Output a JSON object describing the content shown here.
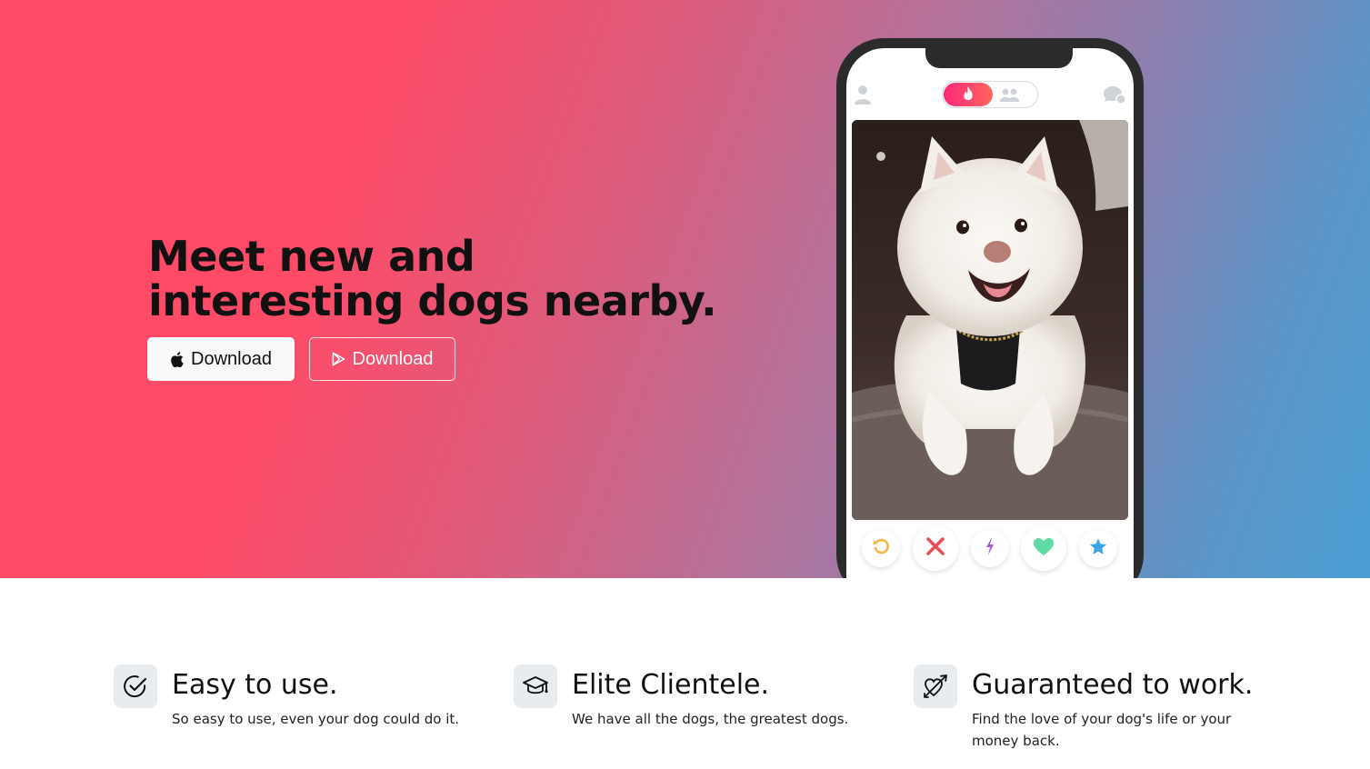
{
  "hero": {
    "title": "Meet new and interesting dogs nearby.",
    "buttons": [
      {
        "label": "Download",
        "icon": "apple-icon"
      },
      {
        "label": "Download",
        "icon": "google-play-icon"
      }
    ],
    "gradient_colors": [
      "#ff4b67",
      "#4a9ed4"
    ]
  },
  "phone": {
    "topbar": {
      "left_icon": "profile-icon",
      "toggle_active_icon": "flame-icon",
      "toggle_inactive_icon": "group-icon",
      "right_icon": "chat-icon"
    },
    "card": {
      "image": "white-pomeranian-dog-photo"
    },
    "actions": [
      {
        "icon": "rewind-icon",
        "color": "#f5b748"
      },
      {
        "icon": "close-icon",
        "color": "#e94d58"
      },
      {
        "icon": "boost-icon",
        "color": "#a35fd0"
      },
      {
        "icon": "heart-icon",
        "color": "#5fd9a5"
      },
      {
        "icon": "star-icon",
        "color": "#3aa5e6"
      }
    ],
    "accent": "#fd297b"
  },
  "features": [
    {
      "icon": "check-circle-icon",
      "title": "Easy to use.",
      "text": "So easy to use, even your dog could do it."
    },
    {
      "icon": "graduation-cap-icon",
      "title": "Elite Clientele.",
      "text": "We have all the dogs, the greatest dogs."
    },
    {
      "icon": "heart-arrow-icon",
      "title": "Guaranteed to work.",
      "text": "Find the love of your dog's life or your money back."
    }
  ]
}
